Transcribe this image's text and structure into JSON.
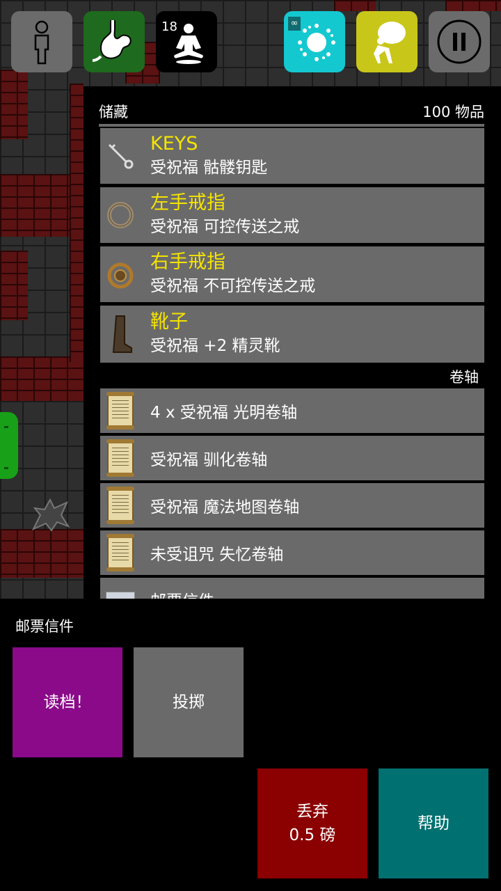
{
  "top_bar": {
    "meditation_count": "18",
    "infinity_mark": "∞",
    "icons": [
      "body-icon",
      "stomach-icon",
      "meditation-icon",
      "magic-burst-icon",
      "loot-sack-icon",
      "pause-icon"
    ]
  },
  "inventory": {
    "title": "储藏",
    "count": "100 物品",
    "equipped": [
      {
        "name": "KEYS",
        "desc": "受祝福 骷髅钥匙",
        "icon": "key-icon"
      },
      {
        "name": "左手戒指",
        "desc": "受祝福 可控传送之戒",
        "icon": "ring-icon"
      },
      {
        "name": "右手戒指",
        "desc": "受祝福 不可控传送之戒",
        "icon": "jeweled-ring-icon"
      },
      {
        "name": "靴子",
        "desc": "受祝福 +2 精灵靴",
        "icon": "boot-icon"
      }
    ],
    "scrolls_label": "卷轴",
    "scrolls": [
      {
        "text": "4 x 受祝福 光明卷轴",
        "icon": "scroll-icon"
      },
      {
        "text": "受祝福 驯化卷轴",
        "icon": "scroll-icon"
      },
      {
        "text": "受祝福 魔法地图卷轴",
        "icon": "scroll-icon"
      },
      {
        "text": "未受诅咒 失忆卷轴",
        "icon": "scroll-icon"
      },
      {
        "text": "邮票信件",
        "icon": "letter-icon"
      }
    ]
  },
  "action_sheet": {
    "title": "邮票信件",
    "read_label": "读档！",
    "throw_label": "投掷",
    "drop_label": "丢弃",
    "drop_weight": "0.5 磅",
    "help_label": "帮助"
  },
  "colors": {
    "highlight_yellow": "#f5e400",
    "row_gray": "#6a6a6a",
    "read_purple": "#8a0a8a",
    "drop_red": "#8b0000",
    "help_teal": "#007070"
  }
}
